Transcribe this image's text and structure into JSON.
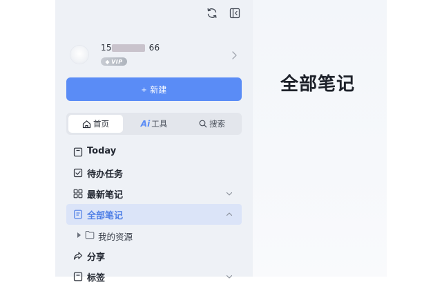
{
  "account": {
    "phone_prefix": "15",
    "phone_suffix": "66",
    "vip_label": "VIP"
  },
  "toolbar": {
    "sync_icon": "sync-icon",
    "collapse_icon": "sidebar-collapse-icon"
  },
  "new_button": {
    "plus": "+",
    "label": "新建"
  },
  "tabs": [
    {
      "label": "首页",
      "icon": "home-icon",
      "active": true
    },
    {
      "label": "工具",
      "prefix": "Ai",
      "icon": "ai-icon",
      "active": false
    },
    {
      "label": "搜索",
      "icon": "search-icon",
      "active": false
    }
  ],
  "nav": {
    "today": "Today",
    "todo": "待办任务",
    "latest": "最新笔记",
    "all": "全部笔记",
    "my_resources": "我的资源",
    "share": "分享",
    "tags": "标签"
  },
  "main": {
    "title": "全部笔记"
  },
  "colors": {
    "accent": "#5a8cf6",
    "active_bg": "#dbe4f8",
    "sidebar_bg": "#eef1f6"
  }
}
